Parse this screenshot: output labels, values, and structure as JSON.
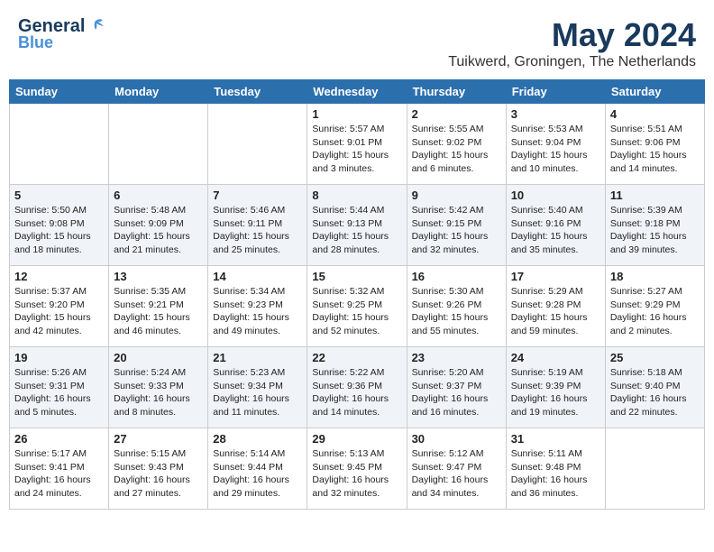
{
  "header": {
    "logo_line1": "General",
    "logo_line2": "Blue",
    "month": "May 2024",
    "location": "Tuikwerd, Groningen, The Netherlands"
  },
  "days_of_week": [
    "Sunday",
    "Monday",
    "Tuesday",
    "Wednesday",
    "Thursday",
    "Friday",
    "Saturday"
  ],
  "weeks": [
    [
      {
        "day": "",
        "info": ""
      },
      {
        "day": "",
        "info": ""
      },
      {
        "day": "",
        "info": ""
      },
      {
        "day": "1",
        "info": "Sunrise: 5:57 AM\nSunset: 9:01 PM\nDaylight: 15 hours and 3 minutes."
      },
      {
        "day": "2",
        "info": "Sunrise: 5:55 AM\nSunset: 9:02 PM\nDaylight: 15 hours and 6 minutes."
      },
      {
        "day": "3",
        "info": "Sunrise: 5:53 AM\nSunset: 9:04 PM\nDaylight: 15 hours and 10 minutes."
      },
      {
        "day": "4",
        "info": "Sunrise: 5:51 AM\nSunset: 9:06 PM\nDaylight: 15 hours and 14 minutes."
      }
    ],
    [
      {
        "day": "5",
        "info": "Sunrise: 5:50 AM\nSunset: 9:08 PM\nDaylight: 15 hours and 18 minutes."
      },
      {
        "day": "6",
        "info": "Sunrise: 5:48 AM\nSunset: 9:09 PM\nDaylight: 15 hours and 21 minutes."
      },
      {
        "day": "7",
        "info": "Sunrise: 5:46 AM\nSunset: 9:11 PM\nDaylight: 15 hours and 25 minutes."
      },
      {
        "day": "8",
        "info": "Sunrise: 5:44 AM\nSunset: 9:13 PM\nDaylight: 15 hours and 28 minutes."
      },
      {
        "day": "9",
        "info": "Sunrise: 5:42 AM\nSunset: 9:15 PM\nDaylight: 15 hours and 32 minutes."
      },
      {
        "day": "10",
        "info": "Sunrise: 5:40 AM\nSunset: 9:16 PM\nDaylight: 15 hours and 35 minutes."
      },
      {
        "day": "11",
        "info": "Sunrise: 5:39 AM\nSunset: 9:18 PM\nDaylight: 15 hours and 39 minutes."
      }
    ],
    [
      {
        "day": "12",
        "info": "Sunrise: 5:37 AM\nSunset: 9:20 PM\nDaylight: 15 hours and 42 minutes."
      },
      {
        "day": "13",
        "info": "Sunrise: 5:35 AM\nSunset: 9:21 PM\nDaylight: 15 hours and 46 minutes."
      },
      {
        "day": "14",
        "info": "Sunrise: 5:34 AM\nSunset: 9:23 PM\nDaylight: 15 hours and 49 minutes."
      },
      {
        "day": "15",
        "info": "Sunrise: 5:32 AM\nSunset: 9:25 PM\nDaylight: 15 hours and 52 minutes."
      },
      {
        "day": "16",
        "info": "Sunrise: 5:30 AM\nSunset: 9:26 PM\nDaylight: 15 hours and 55 minutes."
      },
      {
        "day": "17",
        "info": "Sunrise: 5:29 AM\nSunset: 9:28 PM\nDaylight: 15 hours and 59 minutes."
      },
      {
        "day": "18",
        "info": "Sunrise: 5:27 AM\nSunset: 9:29 PM\nDaylight: 16 hours and 2 minutes."
      }
    ],
    [
      {
        "day": "19",
        "info": "Sunrise: 5:26 AM\nSunset: 9:31 PM\nDaylight: 16 hours and 5 minutes."
      },
      {
        "day": "20",
        "info": "Sunrise: 5:24 AM\nSunset: 9:33 PM\nDaylight: 16 hours and 8 minutes."
      },
      {
        "day": "21",
        "info": "Sunrise: 5:23 AM\nSunset: 9:34 PM\nDaylight: 16 hours and 11 minutes."
      },
      {
        "day": "22",
        "info": "Sunrise: 5:22 AM\nSunset: 9:36 PM\nDaylight: 16 hours and 14 minutes."
      },
      {
        "day": "23",
        "info": "Sunrise: 5:20 AM\nSunset: 9:37 PM\nDaylight: 16 hours and 16 minutes."
      },
      {
        "day": "24",
        "info": "Sunrise: 5:19 AM\nSunset: 9:39 PM\nDaylight: 16 hours and 19 minutes."
      },
      {
        "day": "25",
        "info": "Sunrise: 5:18 AM\nSunset: 9:40 PM\nDaylight: 16 hours and 22 minutes."
      }
    ],
    [
      {
        "day": "26",
        "info": "Sunrise: 5:17 AM\nSunset: 9:41 PM\nDaylight: 16 hours and 24 minutes."
      },
      {
        "day": "27",
        "info": "Sunrise: 5:15 AM\nSunset: 9:43 PM\nDaylight: 16 hours and 27 minutes."
      },
      {
        "day": "28",
        "info": "Sunrise: 5:14 AM\nSunset: 9:44 PM\nDaylight: 16 hours and 29 minutes."
      },
      {
        "day": "29",
        "info": "Sunrise: 5:13 AM\nSunset: 9:45 PM\nDaylight: 16 hours and 32 minutes."
      },
      {
        "day": "30",
        "info": "Sunrise: 5:12 AM\nSunset: 9:47 PM\nDaylight: 16 hours and 34 minutes."
      },
      {
        "day": "31",
        "info": "Sunrise: 5:11 AM\nSunset: 9:48 PM\nDaylight: 16 hours and 36 minutes."
      },
      {
        "day": "",
        "info": ""
      }
    ]
  ]
}
